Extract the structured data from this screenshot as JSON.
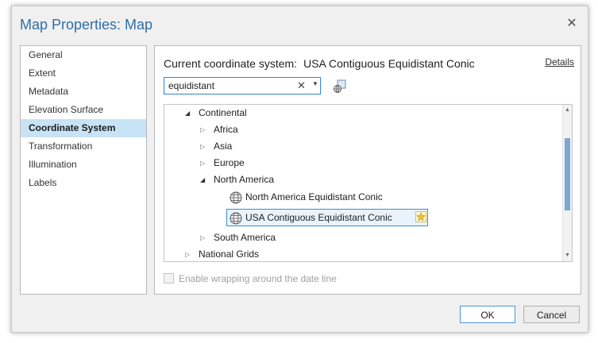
{
  "dialog": {
    "title": "Map Properties: Map",
    "close_icon": "close-icon"
  },
  "sidebar": {
    "items": [
      {
        "label": "General",
        "active": false
      },
      {
        "label": "Extent",
        "active": false
      },
      {
        "label": "Metadata",
        "active": false
      },
      {
        "label": "Elevation Surface",
        "active": false
      },
      {
        "label": "Coordinate System",
        "active": true
      },
      {
        "label": "Transformation",
        "active": false
      },
      {
        "label": "Illumination",
        "active": false
      },
      {
        "label": "Labels",
        "active": false
      }
    ]
  },
  "main": {
    "current_label": "Current coordinate system:",
    "current_value": "USA Contiguous Equidistant Conic",
    "details_link": "Details",
    "search": {
      "value": "equidistant",
      "clear_icon": "clear-icon",
      "dropdown_icon": "chevron-down-icon"
    },
    "filter_icon": "spatial-filter-icon",
    "tree": {
      "continental": "Continental",
      "africa": "Africa",
      "asia": "Asia",
      "europe": "Europe",
      "north_america": "North America",
      "na_equidistant": "North America Equidistant Conic",
      "usa_equidistant": "USA Contiguous Equidistant Conic",
      "south_america": "South America",
      "national_grids": "National Grids"
    },
    "wrap_label": "Enable wrapping around the date line",
    "wrap_checked": false
  },
  "footer": {
    "ok_label": "OK",
    "cancel_label": "Cancel"
  },
  "colors": {
    "accent": "#2f6fa8",
    "selection": "#c7e3f5",
    "focus_border": "#2e86c8"
  }
}
